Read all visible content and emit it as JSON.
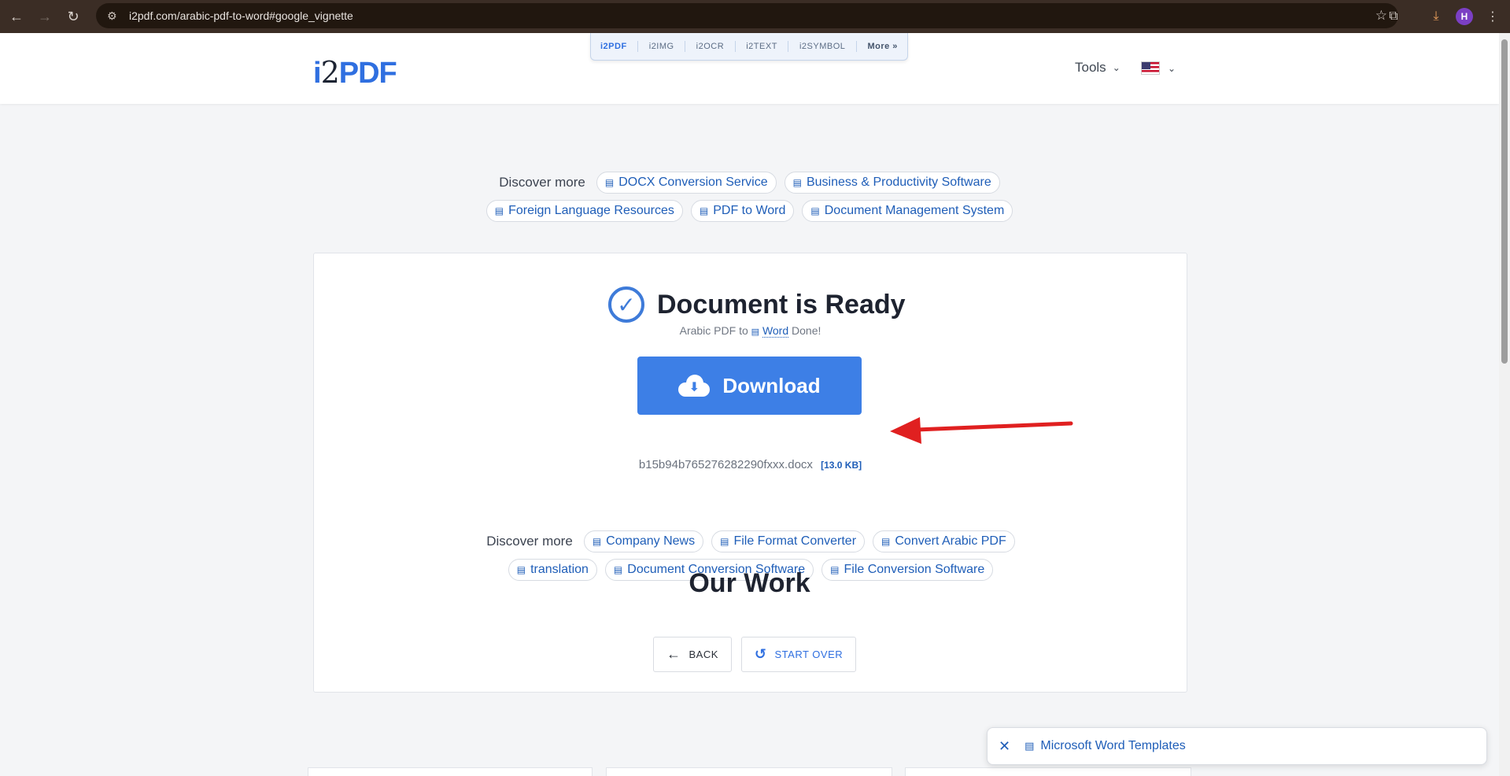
{
  "browser": {
    "url": "i2pdf.com/arabic-pdf-to-word#google_vignette",
    "profile_initial": "H"
  },
  "topnav": {
    "items": [
      "i2PDF",
      "i2IMG",
      "i2OCR",
      "i2TEXT",
      "i2SYMBOL"
    ],
    "more": "More »"
  },
  "header": {
    "logo_i": "i",
    "logo_two": "2",
    "logo_pdf": "PDF",
    "tools_label": "Tools"
  },
  "discover_top": {
    "label": "Discover more",
    "chips": [
      "DOCX Conversion Service",
      "Business & Productivity Software",
      "Foreign Language Resources",
      "PDF to Word",
      "Document Management System"
    ]
  },
  "result": {
    "title": "Document is Ready",
    "subtext_prefix": "Arabic PDF to",
    "subtext_link": "Word",
    "subtext_suffix": "Done!",
    "download_label": "Download",
    "filename": "b15b94b765276282290fxxx.docx",
    "filesize": "[13.0 KB]"
  },
  "discover_bottom": {
    "label": "Discover more",
    "chips": [
      "Company News",
      "File Format Converter",
      "Convert Arabic PDF",
      "translation",
      "Document Conversion Software",
      "File Conversion Software"
    ]
  },
  "actions": {
    "back_label": "BACK",
    "start_over_label": "START OVER"
  },
  "section": {
    "our_work": "Our Work"
  },
  "ad_banner": {
    "link": "Microsoft Word Templates"
  },
  "colors": {
    "accent": "#3d7fe6",
    "link": "#1f5eb8",
    "annotation_arrow": "#e02020"
  }
}
